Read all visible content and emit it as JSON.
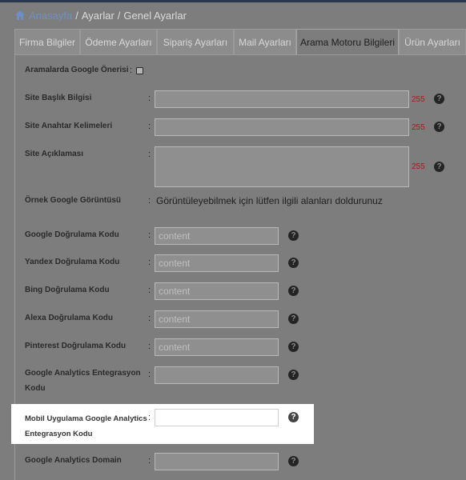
{
  "breadcrumb": {
    "home": "Anasayfa",
    "separator": "/",
    "items": [
      "Ayarlar",
      "Genel Ayarlar"
    ]
  },
  "tabs": [
    {
      "label": "Firma Bilgiler",
      "active": false
    },
    {
      "label": "Ödeme Ayarları",
      "active": false
    },
    {
      "label": "Sipariş Ayarları",
      "active": false
    },
    {
      "label": "Mail Ayarları",
      "active": false
    },
    {
      "label": "Arama Motoru Bilgileri",
      "active": true
    },
    {
      "label": "Ürün Ayarları",
      "active": false
    }
  ],
  "form": {
    "google_suggest": {
      "label": "Aramalarda Google Önerisi",
      "colon": ":",
      "checked": false
    },
    "site_title": {
      "label": "Site Başlık Bilgisi",
      "colon": ":",
      "value": "",
      "counter": "255"
    },
    "site_keywords": {
      "label": "Site Anahtar Kelimeleri",
      "colon": ":",
      "value": "",
      "counter": "255"
    },
    "site_description": {
      "label": "Site Açıklaması",
      "colon": ":",
      "value": "",
      "counter": "255"
    },
    "google_preview": {
      "label": "Örnek Google Görüntüsü",
      "colon": ":",
      "text": "Görüntüleyebilmek için lütfen ilgili alanları doldurunuz"
    },
    "google_verification": {
      "label": "Google Doğrulama Kodu",
      "colon": ":",
      "placeholder": "content"
    },
    "yandex_verification": {
      "label": "Yandex Doğrulama Kodu",
      "colon": ":",
      "placeholder": "content"
    },
    "bing_verification": {
      "label": "Bing Doğrulama Kodu",
      "colon": ":",
      "placeholder": "content"
    },
    "alexa_verification": {
      "label": "Alexa Doğrulama Kodu",
      "colon": ":",
      "placeholder": "content"
    },
    "pinterest_verification": {
      "label": "Pinterest Doğrulama Kodu",
      "colon": ":",
      "placeholder": "content"
    },
    "ga_integration": {
      "label": "Google Analytics Entegrasyon Kodu",
      "colon": ":",
      "value": ""
    },
    "mobile_ga_integration": {
      "label": "Mobil Uygulama Google Analytics Entegrasyon Kodu",
      "colon": ":",
      "value": ""
    },
    "ga_domain": {
      "label": "Google Analytics Domain",
      "colon": ":",
      "value": ""
    }
  },
  "help_icon_glyph": "?",
  "colors": {
    "overlay": "#7d7d7d",
    "highlight": "#ffffff",
    "counter": "#a31c1c",
    "home_link": "#6f8fc4",
    "top_bar": "#2b3650"
  }
}
